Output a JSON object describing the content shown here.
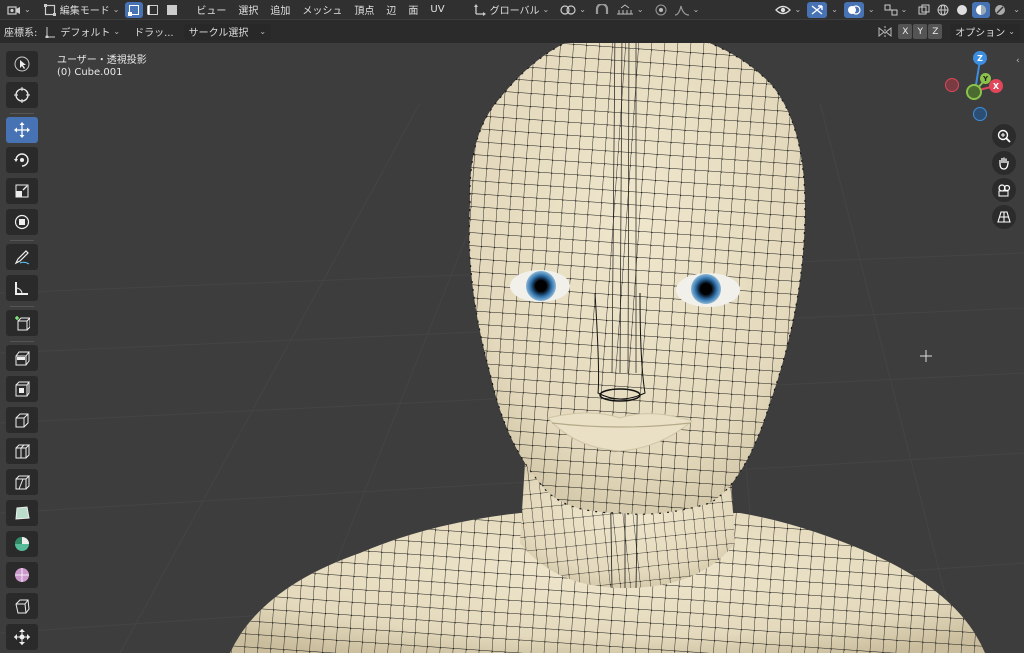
{
  "header": {
    "mode_label": "編集モード",
    "menus": [
      "ビュー",
      "選択",
      "追加",
      "メッシュ",
      "頂点",
      "辺",
      "面",
      "UV"
    ],
    "transform_orientation": "グローバル"
  },
  "toolbar2": {
    "coord_label": "座標系:",
    "orientation_value": "デフォルト",
    "drag_label": "ドラッ...",
    "select_tool_value": "サークル選択",
    "axis_x": "X",
    "axis_y": "Y",
    "axis_z": "Z",
    "options_label": "オプション"
  },
  "viewport": {
    "view_name": "ユーザー・透視投影",
    "object_name": "(0) Cube.001"
  },
  "gizmo": {
    "x": "X",
    "y": "Y",
    "z": "Z"
  },
  "colors": {
    "accent": "#4772b3",
    "skin": "#e8dfc4",
    "background": "#3d3d3d",
    "axis_x": "#e0475a",
    "axis_y": "#8bc34a",
    "axis_z": "#3d8ee0"
  },
  "tools": [
    "cursor-select",
    "3d-cursor",
    "move",
    "rotate",
    "scale",
    "transform",
    "annotate",
    "measure",
    "add-cube",
    "extrude",
    "inset",
    "bevel",
    "loop-cut",
    "knife",
    "poly-build",
    "spin",
    "smooth",
    "shear",
    "shrink-fatten"
  ]
}
